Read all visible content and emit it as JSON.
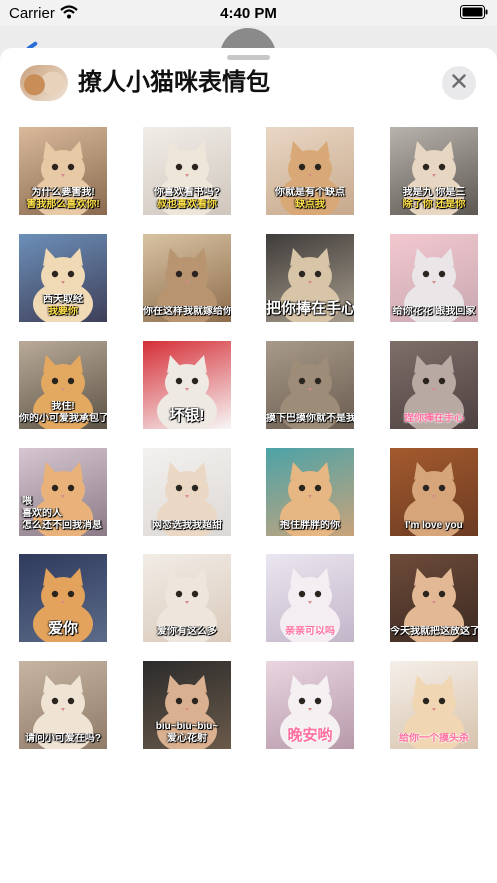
{
  "status_bar": {
    "carrier": "Carrier",
    "time": "4:40 PM"
  },
  "sheet": {
    "title": "撩人小猫咪表情包"
  },
  "stickers": [
    {
      "bg": [
        "#d9b99a",
        "#8a6a4f"
      ],
      "cat": "#e8c9a6",
      "lines": [
        {
          "text": "为什么要害我!",
          "color": "white"
        },
        {
          "text": "害我那么喜欢你!",
          "color": "yellow"
        }
      ]
    },
    {
      "bg": [
        "#f1ede8",
        "#cfc6bd"
      ],
      "cat": "#efe6da",
      "lines": [
        {
          "text": "你喜欢看书吗?",
          "color": "white"
        },
        {
          "text": "叔也喜欢看你",
          "color": "yellow"
        }
      ]
    },
    {
      "bg": [
        "#e9d7c5",
        "#c7a98c"
      ],
      "cat": "#d9a877",
      "lines": [
        {
          "text": "你就是有个缺点",
          "color": "white"
        },
        {
          "text": "缺点我",
          "color": "yellow"
        }
      ]
    },
    {
      "bg": [
        "#b9b3ae",
        "#5c5751"
      ],
      "cat": "#e7d6c2",
      "lines": [
        {
          "text": "我是九 你是三",
          "color": "white"
        },
        {
          "text": "除了你 还是你",
          "color": "yellow"
        }
      ]
    },
    {
      "bg": [
        "#6c8fb8",
        "#3f3f59"
      ],
      "cat": "#f0d9b5",
      "lines": [
        {
          "text": "西天取经",
          "color": "white"
        },
        {
          "text": "我要你",
          "color": "yellow"
        }
      ]
    },
    {
      "bg": [
        "#d8c2a2",
        "#8d6d4c"
      ],
      "cat": "#b89470",
      "lines": [
        {
          "text": "你在这样我就嫁给你喝",
          "color": "white"
        }
      ]
    },
    {
      "bg": [
        "#3f3c3a",
        "#a79c8c"
      ],
      "cat": "#d8c4a6",
      "lines": [
        {
          "text": "把你捧在手心里",
          "color": "white",
          "size": "big"
        }
      ]
    },
    {
      "bg": [
        "#f2c8cf",
        "#c9a8b0"
      ],
      "cat": "#eae6e8",
      "lines": [
        {
          "text": "给你花花 跟我回家",
          "color": "white"
        }
      ]
    },
    {
      "bg": [
        "#b9aa98",
        "#5c5346"
      ],
      "cat": "#e3a960",
      "lines": [
        {
          "text": "我住!",
          "color": "white"
        },
        {
          "text": "你的小可爱我承包了",
          "color": "white"
        }
      ]
    },
    {
      "bg": [
        "#d52e36",
        "#f7f7f7"
      ],
      "cat": "#efe9e3",
      "lines": [
        {
          "text": "坏银!",
          "color": "white",
          "size": "big"
        }
      ]
    },
    {
      "bg": [
        "#a89a8a",
        "#6a5d50"
      ],
      "cat": "#9d8c78",
      "lines": [
        {
          "text": "摸下巴摸你就不是我的我了",
          "color": "white"
        }
      ]
    },
    {
      "bg": [
        "#7f6f6a",
        "#4d4140"
      ],
      "cat": "#b8a9a2",
      "lines": [
        {
          "text": "捏你捧在手心",
          "color": "pink"
        }
      ]
    },
    {
      "bg": [
        "#d6c6d2",
        "#8a7b86"
      ],
      "cat": "#e8b27a",
      "lines": [
        {
          "text": "喂",
          "color": "white"
        },
        {
          "text": "喜欢的人",
          "color": "white"
        },
        {
          "text": "怎么还不回我消息",
          "color": "white"
        }
      ],
      "align": "left"
    },
    {
      "bg": [
        "#f3f1ef",
        "#dcd8d5"
      ],
      "cat": "#ead8c4",
      "lines": [
        {
          "text": "网恋选我我超甜",
          "color": "white"
        }
      ]
    },
    {
      "bg": [
        "#4ba3a8",
        "#c9a37a"
      ],
      "cat": "#e6b783",
      "lines": [
        {
          "text": "抱住胖胖的你",
          "color": "white"
        }
      ]
    },
    {
      "bg": [
        "#a45a2e",
        "#6b3b22"
      ],
      "cat": "#d6a57a",
      "lines": [
        {
          "text": "I'm love you",
          "color": "white"
        }
      ]
    },
    {
      "bg": [
        "#2f3a5c",
        "#5c6b8a"
      ],
      "cat": "#e3a35c",
      "lines": [
        {
          "text": "爱你",
          "color": "white",
          "size": "big"
        }
      ]
    },
    {
      "bg": [
        "#f2ece6",
        "#d9cabb"
      ],
      "cat": "#eee6dc",
      "lines": [
        {
          "text": "爱你有这么多",
          "color": "white"
        }
      ]
    },
    {
      "bg": [
        "#ebe6f0",
        "#c2b6c9"
      ],
      "cat": "#f4eef2",
      "lines": [
        {
          "text": "亲亲可以吗",
          "color": "pink"
        }
      ]
    },
    {
      "bg": [
        "#6e4b39",
        "#3b2a22"
      ],
      "cat": "#e3b995",
      "lines": [
        {
          "text": "今天我就把这放这了",
          "color": "white"
        }
      ]
    },
    {
      "bg": [
        "#c7b4a2",
        "#8f7b67"
      ],
      "cat": "#efe3d4",
      "lines": [
        {
          "text": "请问小可爱在吗?",
          "color": "white"
        }
      ]
    },
    {
      "bg": [
        "#2b2b2b",
        "#6a5a4a"
      ],
      "cat": "#d9b090",
      "lines": [
        {
          "text": "biu~biu~biu~",
          "color": "white"
        },
        {
          "text": "爱心花射",
          "color": "white"
        }
      ]
    },
    {
      "bg": [
        "#e9d5e0",
        "#b79aaa"
      ],
      "cat": "#f5f0f2",
      "lines": [
        {
          "text": "晚安哟",
          "color": "pink",
          "size": "big"
        }
      ]
    },
    {
      "bg": [
        "#f5efe9",
        "#d7c3ad"
      ],
      "cat": "#f0d6b2",
      "lines": [
        {
          "text": "给你一个摸头杀",
          "color": "pink"
        }
      ]
    }
  ]
}
